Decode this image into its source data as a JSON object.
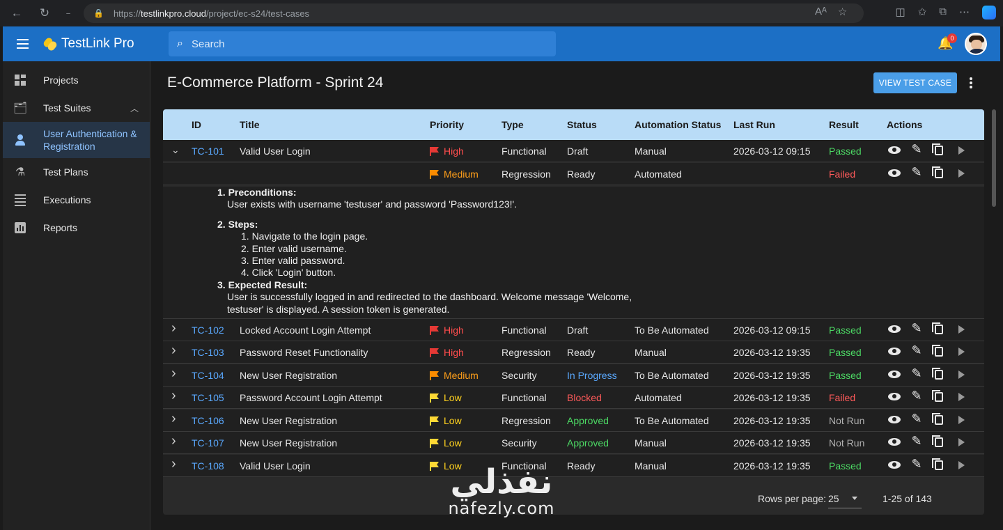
{
  "browser": {
    "url_prefix": "https://",
    "url_host": "testlinkpro.cloud",
    "url_path": "/project/ec-s24/test-cases"
  },
  "app": {
    "name": "TestLink Pro",
    "search_placeholder": "Search",
    "notification_count": "0"
  },
  "sidebar": {
    "items": [
      {
        "label": "Projects",
        "icon": "dashboard-icon"
      },
      {
        "label": "Test Suites",
        "icon": "suitcase-icon"
      },
      {
        "label": "User Authentication & Registration",
        "icon": "person-icon",
        "active": true
      },
      {
        "label": "Test Plans",
        "icon": "flask-icon"
      },
      {
        "label": "Executions",
        "icon": "list-icon"
      },
      {
        "label": "Reports",
        "icon": "chart-icon"
      }
    ]
  },
  "main": {
    "title": "E-Commerce Platform - Sprint 24",
    "view_button": "VIEW TEST CASE"
  },
  "table": {
    "headers": {
      "id": "ID",
      "title": "Title",
      "priority": "Priority",
      "type": "Type",
      "status": "Status",
      "automation": "Automation Status",
      "last_run": "Last Run",
      "result": "Result",
      "actions": "Actions"
    },
    "rows": [
      {
        "expander": "⌄",
        "id": "TC-101",
        "title": "Valid User Login",
        "priority": "High",
        "type": "Functional",
        "status": "Draft",
        "automation": "Manual",
        "last_run": "2026-03-12 09:15",
        "result": "Passed"
      },
      {
        "expander": "",
        "id": "",
        "title": "",
        "priority": "Medium",
        "type": "Regression",
        "status": "Ready",
        "automation": "Automated",
        "last_run": "",
        "result": "Failed"
      },
      {
        "expander": "›",
        "id": "TC-102",
        "title": "Locked Account Login Attempt",
        "priority": "High",
        "type": "Functional",
        "status": "Draft",
        "automation": "To Be Automated",
        "last_run": "2026-03-12 09:15",
        "result": "Passed"
      },
      {
        "expander": "›",
        "id": "TC-103",
        "title": "Password Reset Functionality",
        "priority": "High",
        "type": "Regression",
        "status": "Ready",
        "automation": "Manual",
        "last_run": "2026-03-12 19:35",
        "result": "Passed"
      },
      {
        "expander": "›",
        "id": "TC-104",
        "title": "New User Registration",
        "priority": "Medium",
        "type": "Security",
        "status": "In Progress",
        "automation": "To Be Automated",
        "last_run": "2026-03-12 19:35",
        "result": "Passed"
      },
      {
        "expander": "›",
        "id": "TC-105",
        "title": "Password Account Login Attempt",
        "priority": "Low",
        "type": "Functional",
        "status": "Blocked",
        "automation": "Automated",
        "last_run": "2026-03-12 19:35",
        "result": "Failed"
      },
      {
        "expander": "›",
        "id": "TC-106",
        "title": "New User Registration",
        "priority": "Low",
        "type": "Regression",
        "status": "Approved",
        "automation": "To Be Automated",
        "last_run": "2026-03-12 19:35",
        "result": "Not Run"
      },
      {
        "expander": "›",
        "id": "TC-107",
        "title": "New User Registration",
        "priority": "Low",
        "type": "Security",
        "status": "Approved",
        "automation": "Manual",
        "last_run": "2026-03-12 19:35",
        "result": "Not Run"
      },
      {
        "expander": "›",
        "id": "TC-108",
        "title": "Valid User Login",
        "priority": "Low",
        "type": "Functional",
        "status": "Ready",
        "automation": "Manual",
        "last_run": "2026-03-12 19:35",
        "result": "Passed"
      }
    ],
    "details": {
      "preconditions_title": "1. Preconditions:",
      "preconditions_text": "User exists with username 'testuser' and password 'Password123!'.",
      "steps_title": "2. Steps:",
      "steps": [
        "1. Navigate to the login page.",
        "2. Enter valid username.",
        "3. Enter valid password.",
        "4. Click 'Login' button."
      ],
      "expected_title": "3. Expected Result:",
      "expected_line1": "User is successfully logged in and redirected to the dashboard. Welcome message 'Welcome,",
      "expected_line2": "testuser' is displayed. A session token is generated."
    },
    "footer": {
      "rows_per_page_label": "Rows per page:",
      "rows_per_page_value": "25",
      "range": "1-25 of 143"
    }
  },
  "colors": {
    "High": "#ff4d4d",
    "Medium": "#ff9f1a",
    "Low": "#ffd21f",
    "Passed": "#4cd964",
    "Failed": "#ff5a5a",
    "Not Run": "#b0b0b0",
    "In Progress": "#5aa9ff",
    "Blocked": "#ff5a5a",
    "Approved": "#4cd964",
    "Draft": "#e6e6e6",
    "Ready": "#e6e6e6",
    "flag_high": "#e53935",
    "flag_medium": "#fb8c00",
    "flag_low": "#fdd835"
  },
  "watermark": {
    "arabic": "نفذلي",
    "latin": "nafezly.com"
  }
}
